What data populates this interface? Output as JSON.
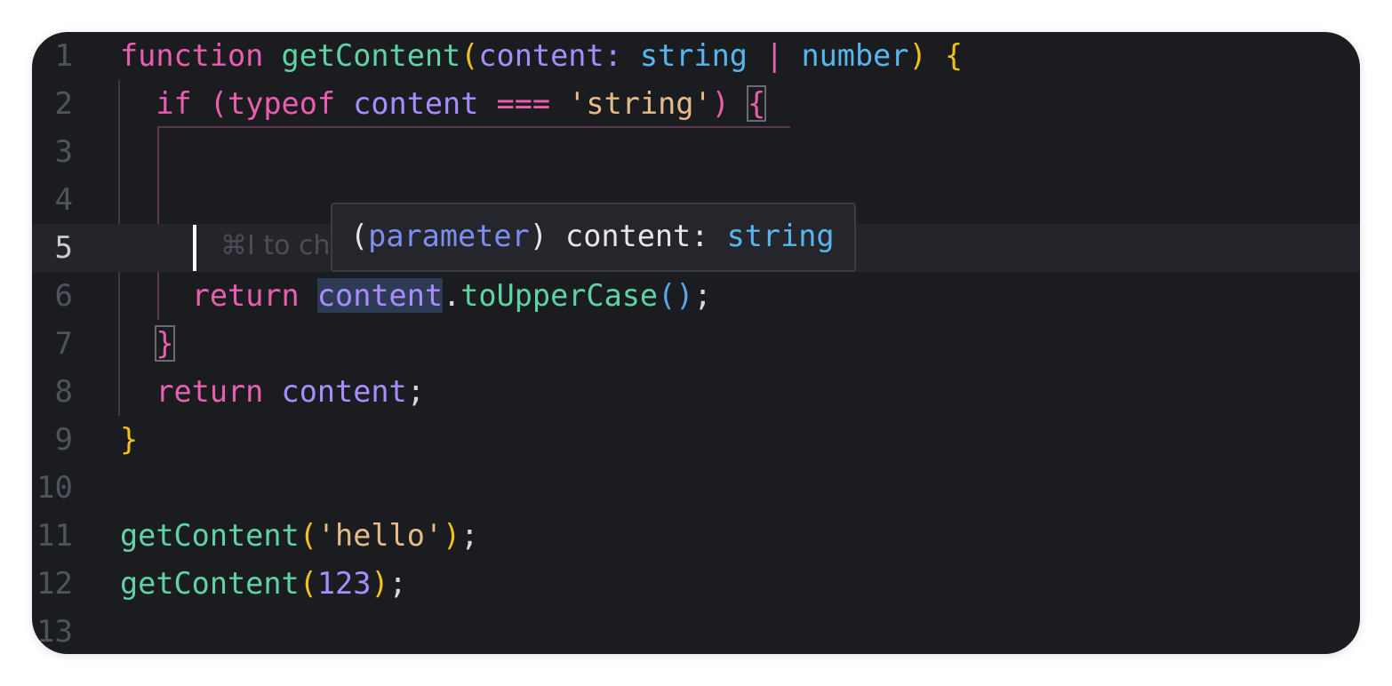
{
  "editor": {
    "active_line": "5",
    "line_numbers": [
      "1",
      "2",
      "3",
      "4",
      "5",
      "6",
      "7",
      "8",
      "9",
      "10",
      "11",
      "12",
      "13"
    ],
    "lines": {
      "l1": {
        "kw_function": "function",
        "fn_name": "getContent",
        "open_paren": "(",
        "param": "content",
        "colon": ":",
        "type_string": "string",
        "pipe": "|",
        "type_number": "number",
        "close_paren": ")",
        "open_brace": "{"
      },
      "l2": {
        "kw_if": "if",
        "open_paren": "(",
        "kw_typeof": "typeof",
        "ident": "content",
        "op": "===",
        "str": "'string'",
        "close_paren": ")",
        "open_brace": "{"
      },
      "l5": {
        "hint": "⌘I to ch"
      },
      "l6": {
        "kw_return": "return",
        "ident": "content",
        "dot": ".",
        "method": "toUpperCase",
        "parens": "()",
        "semi": ";"
      },
      "l7": {
        "close_brace": "}"
      },
      "l8": {
        "kw_return": "return",
        "ident": "content",
        "semi": ";"
      },
      "l9": {
        "close_brace": "}"
      },
      "l11": {
        "fn": "getContent",
        "open_paren": "(",
        "arg": "'hello'",
        "close_paren": ")",
        "semi": ";"
      },
      "l12": {
        "fn": "getContent",
        "open_paren": "(",
        "arg": "123",
        "close_paren": ")",
        "semi": ";"
      }
    }
  },
  "tooltip": {
    "open": "(",
    "kind": "parameter",
    "close": ")",
    "name": "content",
    "colon": ":",
    "type": "string"
  },
  "colors": {
    "background": "#1b1c20",
    "keyword": "#e85fb0",
    "function": "#5fd3a4",
    "parameter": "#a88dff",
    "type": "#58b6ee",
    "string": "#e4bc8a",
    "bracket_level1": "#f1c21b"
  }
}
